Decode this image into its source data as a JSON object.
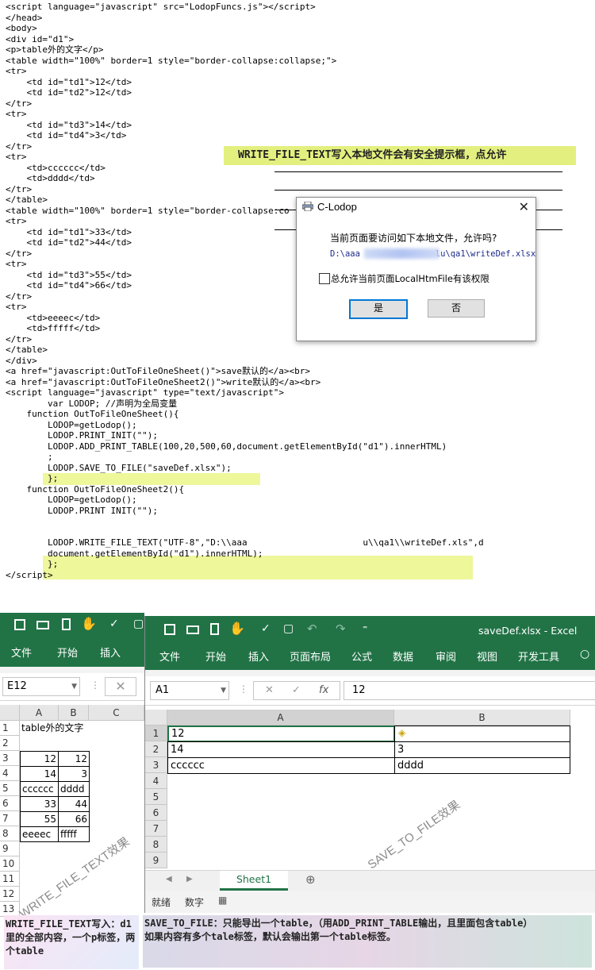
{
  "code_lines": [
    "<script language=\"javascript\" src=\"LodopFuncs.js\"></script>",
    "</head>",
    "<body>",
    "<div id=\"d1\">",
    "<p>table外的文字</p>",
    "<table width=\"100%\" border=1 style=\"border-collapse:collapse;\">",
    "<tr>",
    "    <td id=\"td1\">12</td>",
    "    <td id=\"td2\">12</td>",
    "</tr>",
    "<tr>",
    "    <td id=\"td3\">14</td>",
    "    <td id=\"td4\">3</td>",
    "</tr>",
    "<tr>",
    "    <td>cccccc</td>",
    "    <td>dddd</td>",
    "</tr>",
    "</table>",
    "<table width=\"100%\" border=1 style=\"border-collapse:co",
    "<tr>",
    "    <td id=\"td1\">33</td>",
    "    <td id=\"td2\">44</td>",
    "</tr>",
    "<tr>",
    "    <td id=\"td3\">55</td>",
    "    <td id=\"td4\">66</td>",
    "</tr>",
    "<tr>",
    "    <td>eeeec</td>",
    "    <td>fffff</td>",
    "</tr>",
    "</table>",
    "</div>",
    "<a href=\"javascript:OutToFileOneSheet()\">save默认的</a><br>",
    "<a href=\"javascript:OutToFileOneSheet2()\">write默认的</a><br>",
    "<script language=\"javascript\" type=\"text/javascript\">",
    "        var LODOP; //声明为全局变量",
    "    function OutToFileOneSheet(){",
    "        LODOP=getLodop();",
    "        LODOP.PRINT_INIT(\"\");",
    "        LODOP.ADD_PRINT_TABLE(100,20,500,60,document.getElementById(\"d1\").innerHTML)",
    "        ;",
    "        LODOP.SAVE_TO_FILE(\"saveDef.xlsx\");",
    "        };",
    "    function OutToFileOneSheet2(){",
    "        LODOP=getLodop();",
    "        LODOP.PRINT INIT(\"\");",
    "",
    "",
    "        LODOP.WRITE_FILE_TEXT(\"UTF-8\",\"D:\\\\aaa                      u\\\\qa1\\\\writeDef.xls\",d",
    "        document.getElementById(\"d1\").innerHTML);",
    "        };",
    "</script>"
  ],
  "callout": "WRITE_FILE_TEXT写入本地文件会有安全提示框，点允许",
  "dialog": {
    "title": "C-Lodop",
    "close": "✕",
    "question": "当前页面要访问如下本地文件，允许吗?",
    "path": "D:\\aaa               lu\\qa1\\writeDef.xlsx",
    "checkbox_label": "总允许当前页面LocalHtmFile有该权限",
    "yes": "是",
    "no": "否"
  },
  "excel_left": {
    "tabs": [
      "文件",
      "开始",
      "插入"
    ],
    "namebox": "E12",
    "cols": [
      "A",
      "B",
      "C"
    ],
    "rows": [
      "1",
      "2",
      "3",
      "4",
      "5",
      "6",
      "7",
      "8",
      "9",
      "10",
      "11",
      "12",
      "13"
    ],
    "r1": "table外的文字",
    "r3a": "12",
    "r3b": "12",
    "r4a": "14",
    "r4b": "3",
    "r5a": "cccccc",
    "r5b": "dddd",
    "r6a": "33",
    "r6b": "44",
    "r7a": "55",
    "r7b": "66",
    "r8a": "eeeec",
    "r8b": "fffff",
    "watermark": "WRITE_FILE_TEXT效果"
  },
  "excel_right": {
    "title": "saveDef.xlsx - Excel",
    "tabs": [
      "文件",
      "开始",
      "插入",
      "页面布局",
      "公式",
      "数据",
      "审阅",
      "视图",
      "开发工具"
    ],
    "namebox": "A1",
    "formula": "12",
    "cols": [
      "A",
      "B"
    ],
    "rows": [
      "1",
      "2",
      "3",
      "4",
      "5",
      "6",
      "7",
      "8",
      "9"
    ],
    "r1a": "12",
    "r2a": "14",
    "r2b": "3",
    "r3a": "cccccc",
    "r3b": "dddd",
    "sheet": "Sheet1",
    "status_ready": "就绪",
    "status_num": "数字",
    "watermark": "SAVE_TO_FILE效果"
  },
  "note_left": "WRITE_FILE_TEXT写入：d1里的全部内容，一个p标签，两个table",
  "note_right_1": "SAVE_TO_FILE：只能导出一个table，（用ADD_PRINT_TABLE输出，且里面包含table）",
  "note_right_2": "如果内容有多个tale标签，默认会输出第一个table标签。"
}
